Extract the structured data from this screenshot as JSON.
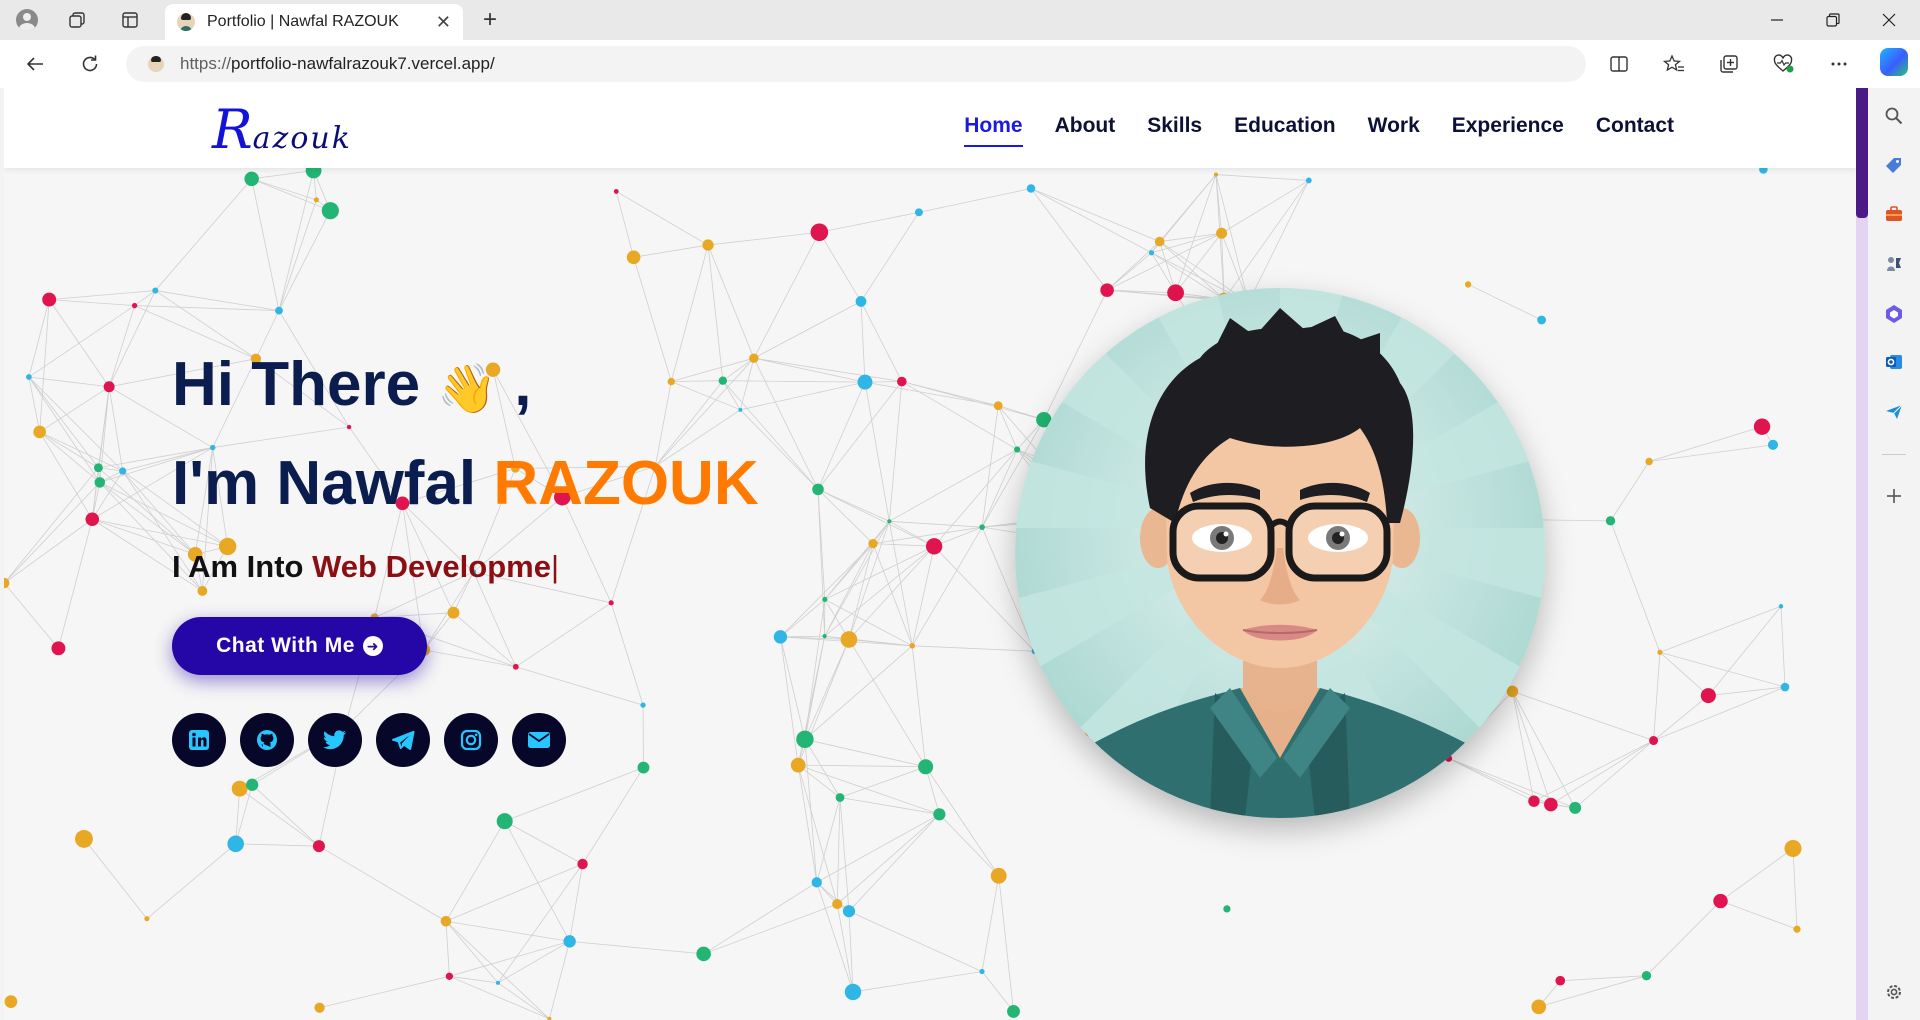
{
  "browser": {
    "tab_title": "Portfolio | Nawfal RAZOUK",
    "tab_close": "✕",
    "new_tab": "+",
    "url_proto": "https://",
    "url_rest": "portfolio-nawfalrazouk7.vercel.app/"
  },
  "site": {
    "logo_initial": "R",
    "logo_rest": "azouk",
    "nav": [
      {
        "label": "Home",
        "active": true
      },
      {
        "label": "About"
      },
      {
        "label": "Skills"
      },
      {
        "label": "Education"
      },
      {
        "label": "Work"
      },
      {
        "label": "Experience"
      },
      {
        "label": "Contact"
      }
    ]
  },
  "hero": {
    "greeting": "Hi There",
    "wave_emoji": "👋",
    "comma": ",",
    "intro": "I'm Nawfal",
    "name": "RAZOUK",
    "role_prefix": "I Am Into",
    "role_typed": "Web Developme",
    "caret": "|",
    "cta_label": "Chat With Me",
    "socials": [
      "linkedin-icon",
      "github-icon",
      "twitter-icon",
      "telegram-icon",
      "instagram-icon",
      "email-icon"
    ]
  },
  "colors": {
    "accent": "#ff7a00",
    "heading": "#0b1d4e",
    "nav_active": "#1a1ae0",
    "cta": "#2506a6",
    "role_typed": "#8b0e12",
    "social_bg": "#07072a",
    "social_icon": "#27c6ff"
  }
}
